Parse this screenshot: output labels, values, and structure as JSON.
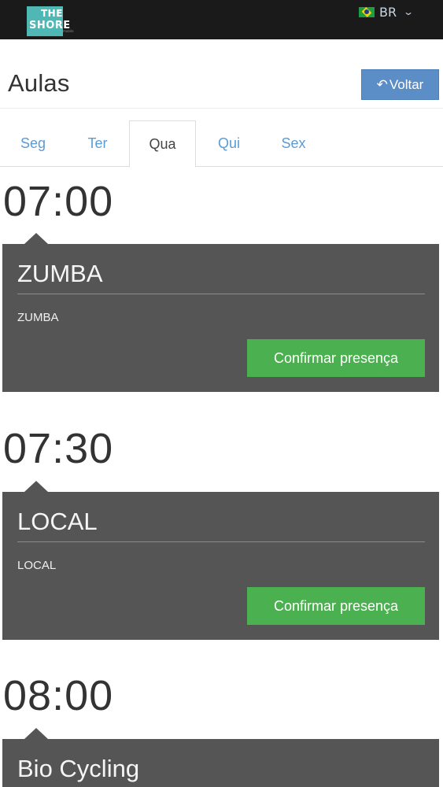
{
  "topbar": {
    "logo": {
      "line1": "THE",
      "line2": "SHORE",
      "sub": "mobile"
    },
    "language": {
      "flag": "brazil-flag-icon",
      "code": "BR",
      "icon": "chevron-down-icon"
    }
  },
  "header": {
    "title": "Aulas",
    "back_label": "Voltar",
    "back_icon": "reply-arrow-icon"
  },
  "tabs": [
    {
      "label": "Seg",
      "active": false
    },
    {
      "label": "Ter",
      "active": false
    },
    {
      "label": "Qua",
      "active": true
    },
    {
      "label": "Qui",
      "active": false
    },
    {
      "label": "Sex",
      "active": false
    }
  ],
  "classes": [
    {
      "time": "07:00",
      "title": "ZUMBA",
      "description": "ZUMBA",
      "button": "Confirmar presença"
    },
    {
      "time": "07:30",
      "title": "LOCAL",
      "description": "LOCAL",
      "button": "Confirmar presença"
    },
    {
      "time": "08:00",
      "title": "Bio Cycling"
    }
  ],
  "colors": {
    "topbar": "#1a1a1a",
    "logo_accent": "#4fb8b5",
    "back_button": "#5b8ec7",
    "tab_link": "#5a9bd5",
    "card": "#555555",
    "confirm_button": "#4bb04f"
  }
}
